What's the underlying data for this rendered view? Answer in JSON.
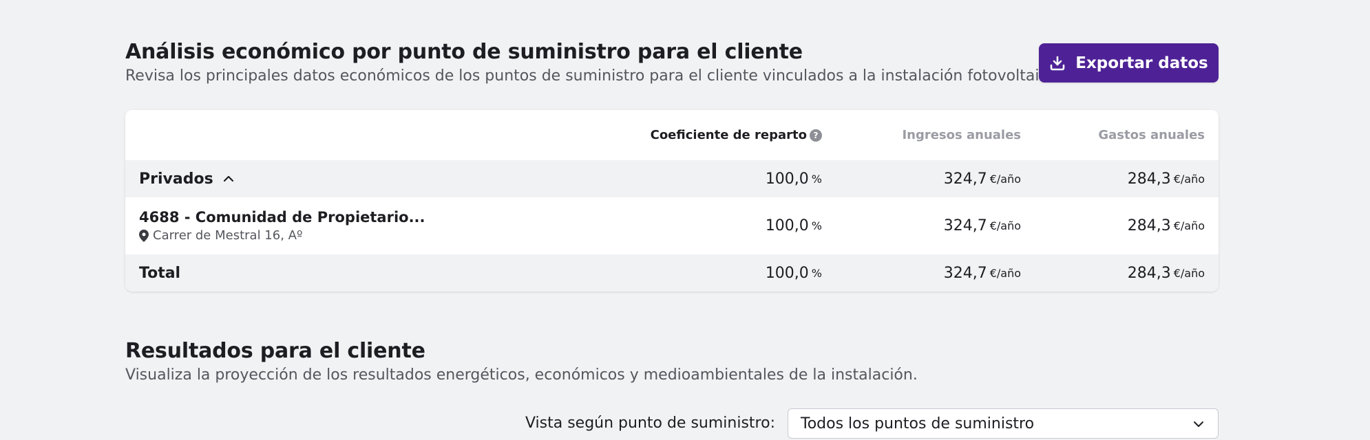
{
  "economic": {
    "title": "Análisis económico por punto de suministro para el cliente",
    "subtitle": "Revisa los principales datos económicos de los puntos de suministro para el cliente vinculados a la instalación fotovoltaica.",
    "export_label": "Exportar datos"
  },
  "table": {
    "headers": {
      "coef": "Coeficiente de reparto",
      "ingresos": "Ingresos anuales",
      "gastos": "Gastos anuales"
    },
    "group": {
      "label": "Privados",
      "coef": "100,0",
      "coef_unit": "%",
      "ingresos": "324,7",
      "ingresos_unit": "€/año",
      "gastos": "284,3",
      "gastos_unit": "€/año"
    },
    "item": {
      "name": "4688 - Comunidad de Propietario...",
      "address": "Carrer de Mestral 16, Aº",
      "coef": "100,0",
      "coef_unit": "%",
      "ingresos": "324,7",
      "ingresos_unit": "€/año",
      "gastos": "284,3",
      "gastos_unit": "€/año"
    },
    "total": {
      "label": "Total",
      "coef": "100,0",
      "coef_unit": "%",
      "ingresos": "324,7",
      "ingresos_unit": "€/año",
      "gastos": "284,3",
      "gastos_unit": "€/año"
    }
  },
  "results": {
    "title": "Resultados para el cliente",
    "subtitle": "Visualiza la proyección de los resultados energéticos, económicos y medioambientales de la instalación.",
    "view_label": "Vista según punto de suministro:",
    "view_selected": "Todos los puntos de suministro"
  },
  "icons": {
    "export": "download-icon",
    "help": "help-circle-icon",
    "group_toggle": "chevron-up-icon",
    "location": "map-pin-icon",
    "select": "chevron-down-icon"
  },
  "colors": {
    "accent": "#4e2296",
    "background": "#f1f2f4"
  }
}
